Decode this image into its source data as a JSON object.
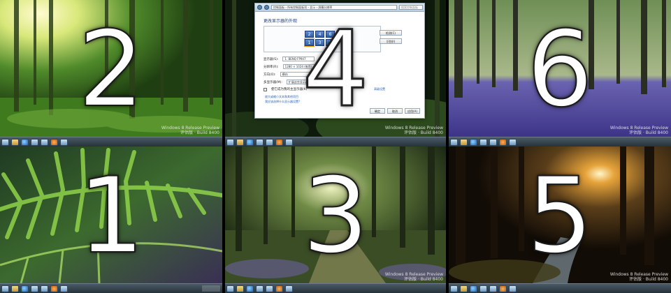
{
  "watermark": {
    "line1": "Windows 8 Release Preview",
    "line2": "评估版 · Build 8400"
  },
  "monitors": [
    {
      "id": "m1",
      "number": "1",
      "scene": "fern-leaf"
    },
    {
      "id": "m2",
      "number": "2",
      "scene": "sunlit-forest"
    },
    {
      "id": "m3",
      "number": "3",
      "scene": "forest-path"
    },
    {
      "id": "m4",
      "number": "4",
      "scene": "dark-forest-with-dialog"
    },
    {
      "id": "m5",
      "number": "5",
      "scene": "sunset-forest-stream"
    },
    {
      "id": "m6",
      "number": "6",
      "scene": "bluebell-forest"
    }
  ],
  "dialog": {
    "address": "控制面板 › 所有控制面板项 › 显示 › 屏幕分辨率",
    "search_placeholder": "搜索控制面板",
    "heading": "更改显示器的外观",
    "layout_numbers": [
      "2",
      "4",
      "1",
      "3",
      "5",
      "6"
    ],
    "detect_label": "检测(C)",
    "identify_label": "识别(I)",
    "rows": [
      {
        "label": "显示器(S):",
        "value": "1. BENQ FP947"
      },
      {
        "label": "分辨率(R):",
        "value": "1280 × 1024 (推荐)"
      },
      {
        "label": "方向(O):",
        "value": "横向"
      },
      {
        "label": "多显示器(M):",
        "value": "扩展这些显示器"
      }
    ],
    "main_display_label": "使它成为我的主显示器(K)",
    "advanced_label": "高级设置",
    "link1": "放大或缩小文本和其他项目",
    "link2": "我应该选择什么显示器设置?",
    "ok_label": "确定",
    "cancel_label": "取消",
    "apply_label": "应用(A)"
  },
  "colors": {
    "digit": "#ffffff",
    "taskbar": "#2f3d47"
  }
}
